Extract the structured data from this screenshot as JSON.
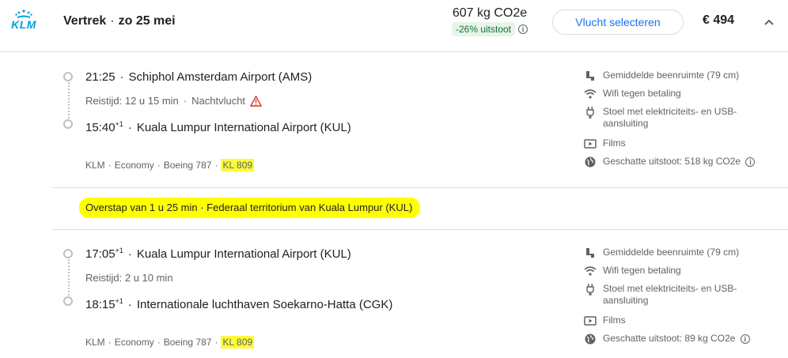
{
  "header": {
    "airline_logo_text": "KLM",
    "title_direction": "Vertrek",
    "title_date": "zo 25 mei",
    "emission_kg": "607 kg CO2e",
    "emission_badge": "-26% uitstoot",
    "select_button": "Vlucht selecteren",
    "price": "€ 494"
  },
  "segments": [
    {
      "dep_time": "21:25",
      "dep_time_sup": "",
      "dep_airport": "Schiphol Amsterdam Airport (AMS)",
      "duration": "Reistijd: 12 u 15 min",
      "duration_extra": "Nachtvlucht",
      "arr_time": "15:40",
      "arr_time_sup": "+1",
      "arr_airport": "Kuala Lumpur International Airport (KUL)",
      "meta": {
        "airline": "KLM",
        "cabin": "Economy",
        "aircraft": "Boeing 787",
        "flight_no": "KL 809"
      },
      "amenities": [
        {
          "icon": "legroom-icon",
          "label": "Gemiddelde beenruimte (79 cm)"
        },
        {
          "icon": "wifi-icon",
          "label": "Wifi tegen betaling"
        },
        {
          "icon": "power-plug-icon",
          "label": "Stoel met elektriciteits- en USB-aansluiting"
        },
        {
          "icon": "video-icon",
          "label": "Films"
        },
        {
          "icon": "globe-icon",
          "label": "Geschatte uitstoot: 518 kg CO2e"
        }
      ]
    },
    {
      "dep_time": "17:05",
      "dep_time_sup": "+1",
      "dep_airport": "Kuala Lumpur International Airport (KUL)",
      "duration": "Reistijd: 2 u 10 min",
      "duration_extra": "",
      "arr_time": "18:15",
      "arr_time_sup": "+1",
      "arr_airport": "Internationale luchthaven Soekarno-Hatta (CGK)",
      "meta": {
        "airline": "KLM",
        "cabin": "Economy",
        "aircraft": "Boeing 787",
        "flight_no": "KL 809"
      },
      "amenities": [
        {
          "icon": "legroom-icon",
          "label": "Gemiddelde beenruimte (79 cm)"
        },
        {
          "icon": "wifi-icon",
          "label": "Wifi tegen betaling"
        },
        {
          "icon": "power-plug-icon",
          "label": "Stoel met elektriciteits- en USB-aansluiting"
        },
        {
          "icon": "video-icon",
          "label": "Films"
        },
        {
          "icon": "globe-icon",
          "label": "Geschatte uitstoot: 89 kg CO2e"
        }
      ]
    }
  ],
  "layover": {
    "text": "Overstap van 1 u 25 min · Federaal territorium van Kuala Lumpur (KUL)"
  },
  "colors": {
    "brand_klm": "#00a1de",
    "accent_link": "#1a73e8",
    "badge_bg": "#e6f4ea",
    "badge_text": "#137333",
    "highlight": "#ffff00",
    "warning": "#d93025"
  }
}
